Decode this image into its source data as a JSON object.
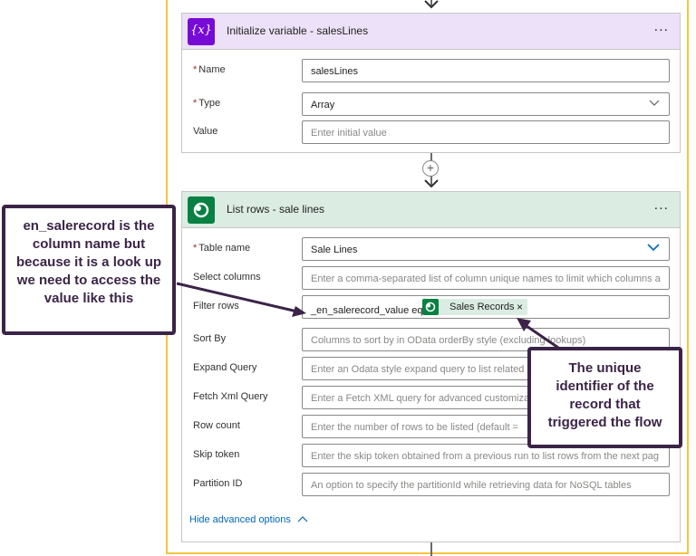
{
  "card1": {
    "title": "Initialize variable - salesLines",
    "icon_text": "{x}",
    "more_label": "...",
    "fields": {
      "name": {
        "label": "Name",
        "value": "salesLines"
      },
      "type": {
        "label": "Type",
        "value": "Array"
      },
      "value": {
        "label": "Value",
        "placeholder": "Enter initial value"
      }
    }
  },
  "card2": {
    "title": "List rows - sale lines",
    "more_label": "...",
    "fields": {
      "table_name": {
        "label": "Table name",
        "value": "Sale Lines"
      },
      "select_columns": {
        "label": "Select columns",
        "placeholder": "Enter a comma-separated list of column unique names to limit which columns a"
      },
      "filter_rows": {
        "label": "Filter rows",
        "value": "_en_salerecord_value eq",
        "token": "Sales Records",
        "token_close": "×"
      },
      "sort_by": {
        "label": "Sort By",
        "placeholder": "Columns to sort by in OData orderBy style (excluding lookups)"
      },
      "expand_query": {
        "label": "Expand Query",
        "placeholder": "Enter an Odata style expand query to list related"
      },
      "fetch_xml": {
        "label": "Fetch Xml Query",
        "placeholder": "Enter a Fetch XML query for advanced customiza"
      },
      "row_count": {
        "label": "Row count",
        "placeholder": "Enter the number of rows to be listed (default ="
      },
      "skip_token": {
        "label": "Skip token",
        "placeholder": "Enter the skip token obtained from a previous run to list rows from the next pag"
      },
      "partition_id": {
        "label": "Partition ID",
        "placeholder": "An option to specify the partitionId while retrieving data for NoSQL tables"
      }
    },
    "hide_advanced": "Hide advanced options"
  },
  "callouts": {
    "left": "en_salerecord is the column name but because it is a look up we need to access the value like this",
    "right": "The unique identifier of the record that triggered the flow"
  },
  "required_marker": "*",
  "colors": {
    "variable_header": "#ece1f8",
    "dataverse_header": "#dbece3",
    "callout": "#3b2447",
    "border": "#f2c53d"
  }
}
